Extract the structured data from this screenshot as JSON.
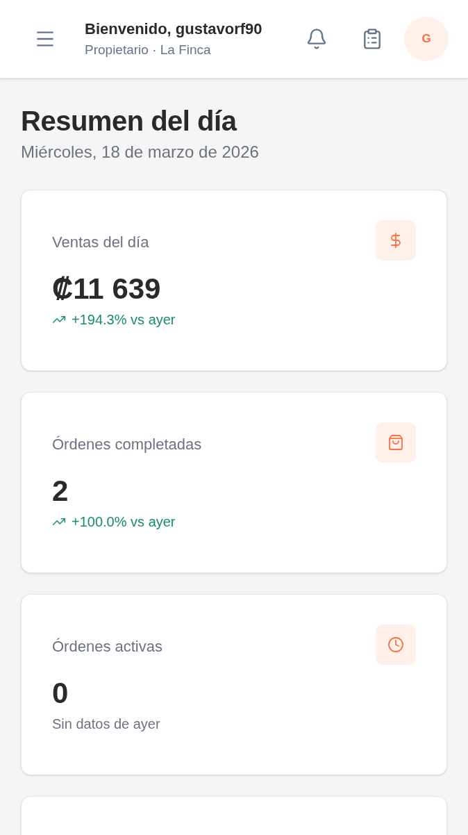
{
  "header": {
    "title": "Bienvenido, gustavorf90",
    "subtitle": "Propietario · La Finca",
    "avatar": "G"
  },
  "page": {
    "title": "Resumen del día",
    "date": "Miércoles, 18 de marzo de 2026"
  },
  "cards": [
    {
      "kind": "dollar",
      "label": "Ventas del día",
      "value": "₡11 639",
      "trend": {
        "kind": "up",
        "text": "+194.3% vs ayer"
      }
    },
    {
      "kind": "bag",
      "label": "Órdenes completadas",
      "value": "2",
      "trend": {
        "kind": "up",
        "text": "+100.0% vs ayer"
      }
    },
    {
      "kind": "clock",
      "label": "Órdenes activas",
      "value": "0",
      "trend": {
        "kind": "none",
        "text": "Sin datos de ayer"
      }
    }
  ]
}
